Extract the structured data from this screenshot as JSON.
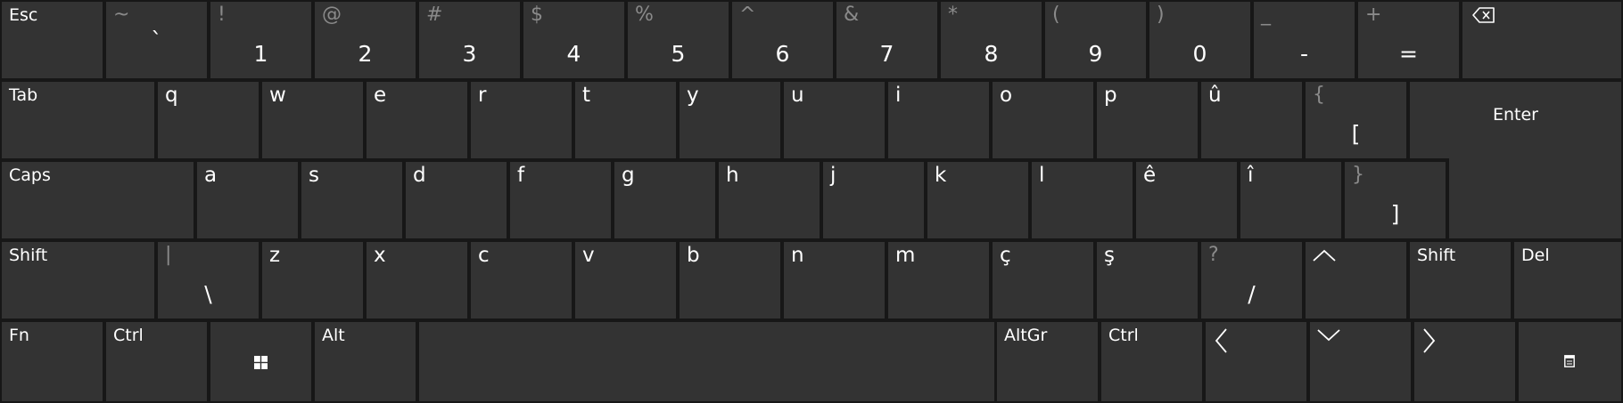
{
  "keyboard": {
    "row1": {
      "esc": "Esc",
      "k1": {
        "top": "~",
        "bottom": "`"
      },
      "k2": {
        "top": "!",
        "bottom": "1"
      },
      "k3": {
        "top": "@",
        "bottom": "2"
      },
      "k4": {
        "top": "#",
        "bottom": "3"
      },
      "k5": {
        "top": "$",
        "bottom": "4"
      },
      "k6": {
        "top": "%",
        "bottom": "5"
      },
      "k7": {
        "top": "^",
        "bottom": "6"
      },
      "k8": {
        "top": "&",
        "bottom": "7"
      },
      "k9": {
        "top": "*",
        "bottom": "8"
      },
      "k10": {
        "top": "(",
        "bottom": "9"
      },
      "k11": {
        "top": ")",
        "bottom": "0"
      },
      "k12": {
        "top": "_",
        "bottom": "-"
      },
      "k13": {
        "top": "+",
        "bottom": "="
      },
      "backspace_icon": "backspace-icon"
    },
    "row2": {
      "tab": "Tab",
      "letters": [
        "q",
        "w",
        "e",
        "r",
        "t",
        "y",
        "u",
        "i",
        "o",
        "p",
        "û"
      ],
      "bracket": {
        "top": "{",
        "bottom": "["
      },
      "enter": "Enter"
    },
    "row3": {
      "caps": "Caps",
      "letters": [
        "a",
        "s",
        "d",
        "f",
        "g",
        "h",
        "j",
        "k",
        "l",
        "ê",
        "î"
      ],
      "bracket": {
        "top": "}",
        "bottom": "]"
      }
    },
    "row4": {
      "shift_left": "Shift",
      "backslash": {
        "top": "|",
        "bottom": "\\"
      },
      "letters": [
        "z",
        "x",
        "c",
        "v",
        "b",
        "n",
        "m",
        "ç",
        "ş"
      ],
      "slash": {
        "top": "?",
        "bottom": "/"
      },
      "up_icon": "arrow-up-icon",
      "shift_right": "Shift",
      "del": "Del"
    },
    "row5": {
      "fn": "Fn",
      "ctrl_left": "Ctrl",
      "windows_icon": "windows-icon",
      "alt": "Alt",
      "altgr": "AltGr",
      "ctrl_right": "Ctrl",
      "left_icon": "arrow-left-icon",
      "down_icon": "arrow-down-icon",
      "right_icon": "arrow-right-icon",
      "menu_icon": "keyboard-settings-icon"
    },
    "colors": {
      "background": "#171717",
      "key": "#333333",
      "text": "#ffffff",
      "secondary_text": "#8a8a8a"
    }
  }
}
